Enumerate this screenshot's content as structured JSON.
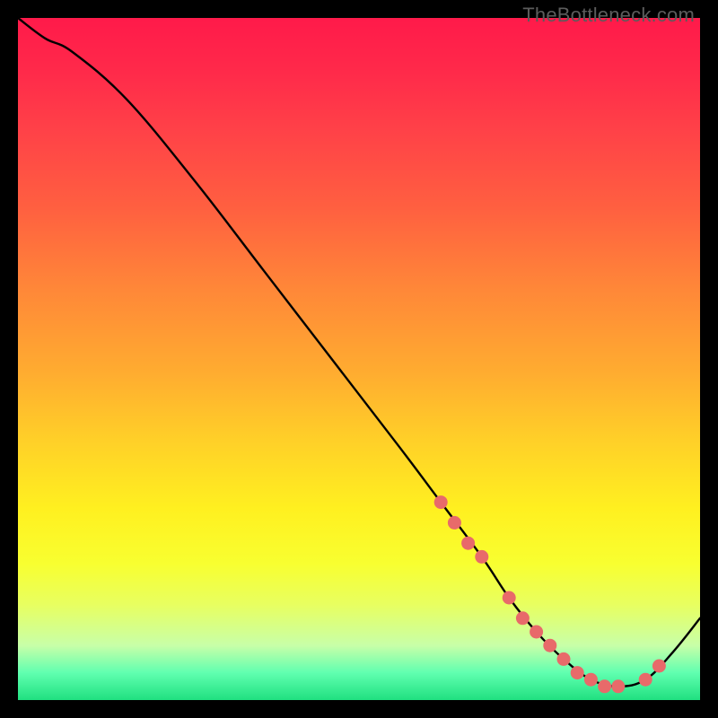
{
  "watermark": "TheBottleneck.com",
  "chart_data": {
    "type": "line",
    "title": "",
    "xlabel": "",
    "ylabel": "",
    "xlim": [
      0,
      100
    ],
    "ylim": [
      0,
      100
    ],
    "series": [
      {
        "name": "bottleneck-curve",
        "x": [
          0,
          4,
          8,
          16,
          26,
          36,
          46,
          56,
          62,
          68,
          72,
          76,
          80,
          84,
          88,
          92,
          96,
          100
        ],
        "y": [
          100,
          97,
          95,
          88,
          76,
          63,
          50,
          37,
          29,
          21,
          15,
          10,
          6,
          3,
          2,
          3,
          7,
          12
        ]
      }
    ],
    "markers": {
      "name": "highlight-dots",
      "color": "#e86a6a",
      "points_x": [
        62,
        64,
        66,
        68,
        72,
        74,
        76,
        78,
        80,
        82,
        84,
        86,
        88,
        92,
        94
      ],
      "points_y": [
        29,
        26,
        23,
        21,
        15,
        12,
        10,
        8,
        6,
        4,
        3,
        2,
        2,
        3,
        5
      ]
    }
  }
}
